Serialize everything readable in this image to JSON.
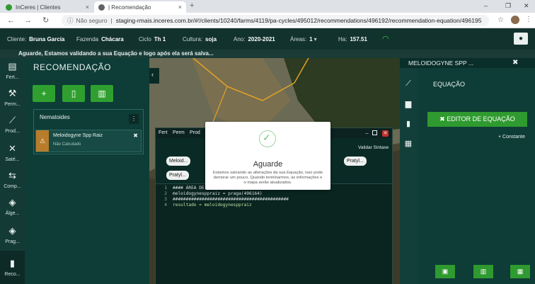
{
  "browser": {
    "tabs": [
      {
        "title": "InCeres | Clientes",
        "close": "×"
      },
      {
        "title": "| Recomendação",
        "close": "×"
      }
    ],
    "new_tab": "+",
    "window_controls": {
      "minimize": "–",
      "restore": "❐",
      "close": "✕"
    },
    "url_security": "Não seguro",
    "url": "staging-rmais.inceres.com.br/#!/clients/10240/farms/4119/pa-cycles/495012/recommendations/496192/recommendation-equation/496195",
    "nav": {
      "back": "←",
      "forward": "→",
      "reload": "↻"
    }
  },
  "header": {
    "client_label": "Cliente:",
    "client_value": "Bruna Garcia",
    "farm_label": "Fazenda",
    "farm_value": "Chácara",
    "cycle_label": "Ciclo",
    "cycle_value": "Th 1",
    "crop_label": "Cultura:",
    "crop_value": "soja",
    "year_label": "Ano:",
    "year_value": "2020-2021",
    "areas_label": "Áreas:",
    "areas_value": "1",
    "ha_label": "Ha:",
    "ha_value": "157.51"
  },
  "banner": "Aguarde, Estamos validando a sua Equação e logo após ela será salva...",
  "rail": [
    {
      "label": "Fert...",
      "icon": "fertilizer-icon"
    },
    {
      "label": "Perm...",
      "icon": "permission-icon"
    },
    {
      "label": "Prod...",
      "icon": "chart-line-icon"
    },
    {
      "label": "Saté...",
      "icon": "satellite-icon"
    },
    {
      "label": "Comp...",
      "icon": "compare-icon"
    },
    {
      "label": "Álge...",
      "icon": "layers-icon"
    },
    {
      "label": "Prag...",
      "icon": "layers-icon"
    },
    {
      "label": "Reco...",
      "icon": "bottle-icon"
    }
  ],
  "panel": {
    "title": "RECOMENDAÇÃO",
    "nematoides_title": "Nematoides",
    "item_name": "Meloidogyne Spp Raiz",
    "item_status": "Não Calculado"
  },
  "editor": {
    "menu": [
      "Fert",
      "Perm",
      "Prod"
    ],
    "validate": "Validar Sintaxe",
    "pills": [
      "Meloid...",
      "Pratyl...",
      "Pratyl..."
    ],
    "code": [
      {
        "n": "1",
        "text": "#### ÁREA DE"
      },
      {
        "n": "2",
        "text": "meloidogynesppraiz = praga(496164)"
      },
      {
        "n": "3",
        "text": "############################################"
      },
      {
        "n": "4",
        "text": "resultado = meloidogynesppraiz"
      }
    ]
  },
  "modal": {
    "title": "Aguarde",
    "message": "Estamos salvando as alterações da sua Equação, isso pode demorar um pouco. Quando terminarmos, as informações e o mapa serão atualizados."
  },
  "right_panel": {
    "title": "MELOIDOGYNE SPP ...",
    "section": "EQUAÇÃO",
    "editor_button": "EDITOR DE EQUAÇÃO",
    "constant_link": "Constante"
  },
  "colors": {
    "accent_green": "#2f9a2f",
    "header_bg": "#12322e",
    "panel_bg": "#0e3c37"
  }
}
